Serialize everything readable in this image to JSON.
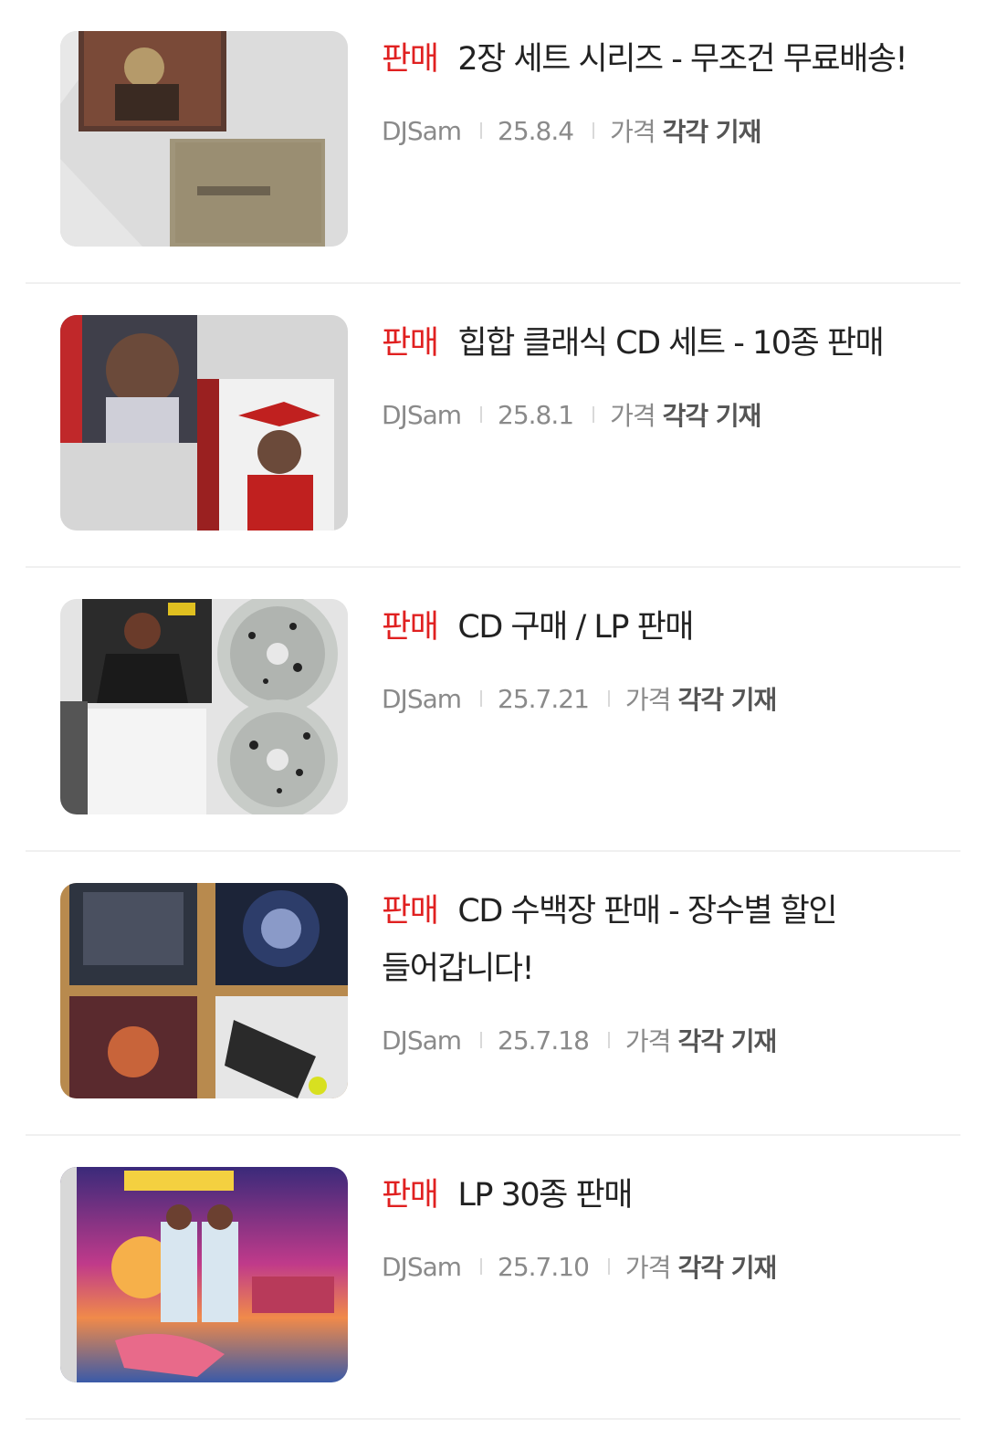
{
  "posts": [
    {
      "tag": "판매",
      "title": "2장 세트 시리즈 - 무조건 무료배송!",
      "author": "DJSam",
      "date": "25.8.4",
      "price_label": "가격",
      "price_value": "각각 기재",
      "thumbnail": "two-cds-stacked"
    },
    {
      "tag": "판매",
      "title": "힙합 클래식 CD 세트 - 10종 판매",
      "author": "DJSam",
      "date": "25.8.1",
      "price_label": "가격",
      "price_value": "각각 기재",
      "thumbnail": "baby-and-graduate-cds"
    },
    {
      "tag": "판매",
      "title": "CD 구매 / LP 판매",
      "author": "DJSam",
      "date": "25.7.21",
      "price_label": "가격",
      "price_value": "각각 기재",
      "thumbnail": "splatter-vinyl-lps"
    },
    {
      "tag": "판매",
      "title": "CD 수백장 판매 - 장수별 할인 들어갑니다!",
      "author": "DJSam",
      "date": "25.7.18",
      "price_label": "가격",
      "price_value": "각각 기재",
      "thumbnail": "four-cd-grid"
    },
    {
      "tag": "판매",
      "title": "LP 30종 판매",
      "author": "DJSam",
      "date": "25.7.10",
      "price_label": "가격",
      "price_value": "각각 기재",
      "thumbnail": "pinata-lp-cover"
    }
  ],
  "colors": {
    "tag": "#e02020",
    "title": "#222222",
    "meta": "#8a8a8a",
    "price_value": "#555555",
    "divider": "#f0f0f0"
  }
}
